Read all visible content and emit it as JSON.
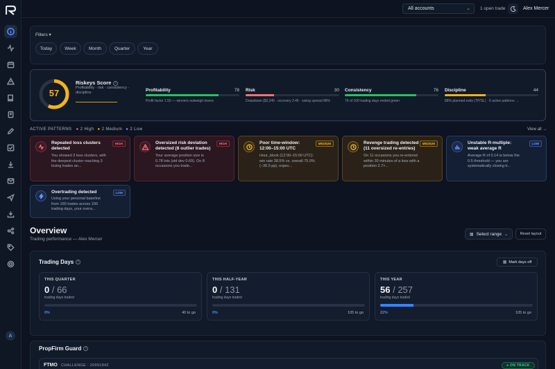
{
  "topbar": {
    "account_select": "All accounts",
    "open_trade": "1 open trade",
    "user_name": "Alex Mercer"
  },
  "sidebar": {
    "avatar_initial": "A",
    "icons": [
      "info-icon",
      "activity-icon",
      "calendar-icon",
      "warning-icon",
      "book-icon",
      "notebook-icon",
      "pen-icon",
      "checklist-icon",
      "download-icon",
      "mail-icon",
      "send-icon",
      "import-icon",
      "share-icon",
      "tag-icon",
      "settings-icon"
    ]
  },
  "filters": {
    "label": "Filters",
    "pills": [
      "Today",
      "Week",
      "Month",
      "Quarter",
      "Year"
    ]
  },
  "score": {
    "value": 57,
    "title": "Riskeys Score",
    "subtitle": "Profitability · risk · consistency · discipline",
    "gauge_fraction": 0.57,
    "metrics": [
      {
        "name": "Profitability",
        "value": 78,
        "note": "Profit factor 1.55 — winners outweigh losers",
        "color": "#22c55e"
      },
      {
        "name": "Risk",
        "value": 30,
        "note": "Drawdown ($2,240 · recovery 2.45 · sizing spread 88%",
        "color": "#f87171"
      },
      {
        "name": "Consistency",
        "value": 76,
        "note": "76 of 100 trading days ended green",
        "color": "#22c55e"
      },
      {
        "name": "Discipline",
        "value": 44,
        "note": "88% planned exits (TP/SL) · 6 active patterns →",
        "color": "#f5b21b"
      }
    ]
  },
  "patterns": {
    "header": "ACTIVE PATTERNS",
    "count_high": "2 High",
    "count_medium": "2 Medium",
    "count_low": "2 Low",
    "view_all": "View all →",
    "cards": [
      {
        "severity": "high",
        "badge": "HIGH",
        "title": "Repeated loss clusters detected",
        "desc": "You showed 3 loss clusters, with the deepest cluster reaching 3 losing trades an..."
      },
      {
        "severity": "high",
        "badge": "HIGH",
        "title": "Oversized risk deviation detected (8 outlier trades)",
        "desc": "Your average position size is 0.78 lots (std dev 0.69). On 8 occasions you trade..."
      },
      {
        "severity": "medium",
        "badge": "MEDIUM",
        "title": "Poor time-window: 12:00–15:00 UTC",
        "desc": "Hour_block (12:00–15:00 UTC): win rate 38.5% vs. overall 75.0% (−36.5 pp). expec..."
      },
      {
        "severity": "medium",
        "badge": "MEDIUM",
        "title": "Revenge trading detected (11 oversized re-entries)",
        "desc": "On 11 occasions you re-entered within 30 minutes of a loss with a position 2.7×..."
      },
      {
        "severity": "low",
        "badge": "LOW",
        "title": "Unstable R-multiple: weak average R",
        "desc": "Average R of 0.14 is below the 0.5 threshold — you are systematically closing tr..."
      },
      {
        "severity": "low",
        "badge": "LOW",
        "title": "Overtrading detected",
        "desc": "Using your personal baseline from 160 trades across 100 trading days, your overa..."
      }
    ]
  },
  "overview": {
    "title": "Overview",
    "subtitle": "Trading performance — Alex Mercer",
    "select_range": "Select range",
    "reset_layout": "Reset layout"
  },
  "trading_days": {
    "title": "Trading Days",
    "mark_days_off": "Mark days off",
    "cards": [
      {
        "period": "THIS QUARTER",
        "traded": "0",
        "total": "66",
        "label": "trading days traded",
        "progress": 0.0,
        "pct": "0%",
        "to_go": "40 to go"
      },
      {
        "period": "THIS HALF-YEAR",
        "traded": "0",
        "total": "131",
        "label": "trading days traded",
        "progress": 0.0,
        "pct": "0%",
        "to_go": "105 to go"
      },
      {
        "period": "THIS YEAR",
        "traded": "56",
        "total": "257",
        "label": "trading days traded",
        "progress": 0.22,
        "pct": "22%",
        "to_go": "105 to go"
      }
    ]
  },
  "propfirm": {
    "title": "PropFirm Guard",
    "firm": "FTMO",
    "account": "CHALLENGE · 20991842",
    "status": "ON TRACK"
  }
}
